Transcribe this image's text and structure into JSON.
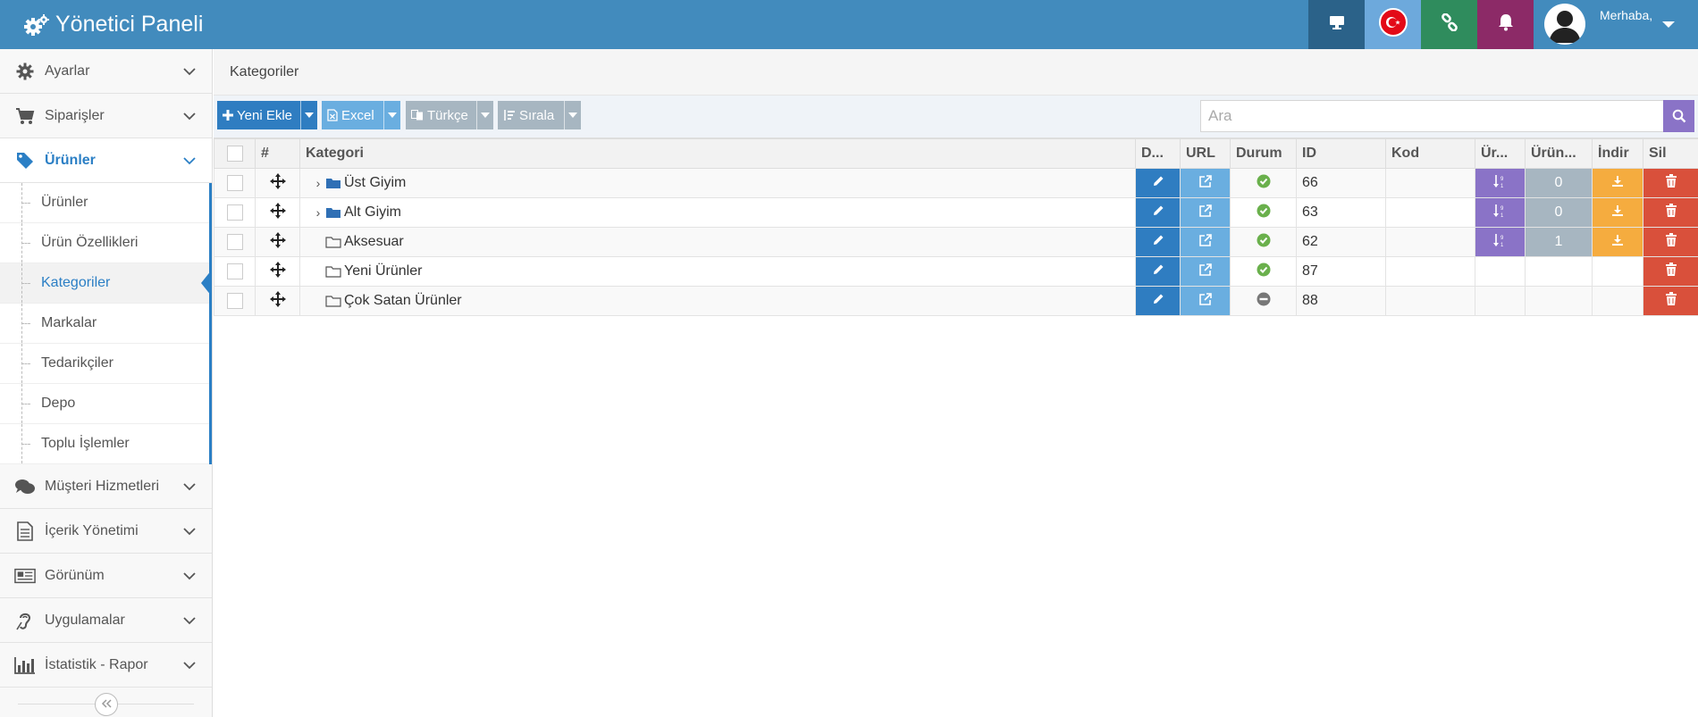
{
  "header": {
    "title": "Yönetici Paneli",
    "greeting": "Merhaba,"
  },
  "colors": {
    "header": "#428bbd",
    "primary": "#2f7dc1",
    "info": "#6aaee0",
    "purple": "#8a73c7",
    "grey": "#a7b6c1",
    "orange": "#f5ac3f",
    "danger": "#d9503b",
    "success": "#6ab04c"
  },
  "sidebar": {
    "items": [
      {
        "label": "Ayarlar",
        "icon": "gear-icon"
      },
      {
        "label": "Siparişler",
        "icon": "cart-icon"
      },
      {
        "label": "Ürünler",
        "icon": "tag-icon"
      },
      {
        "label": "Müşteri Hizmetleri",
        "icon": "comments-icon"
      },
      {
        "label": "İçerik Yönetimi",
        "icon": "document-icon"
      },
      {
        "label": "Görünüm",
        "icon": "newspaper-icon"
      },
      {
        "label": "Uygulamalar",
        "icon": "hearing-icon"
      },
      {
        "label": "İstatistik - Rapor",
        "icon": "bar-chart-icon"
      }
    ],
    "submenu": [
      "Ürünler",
      "Ürün Özellikleri",
      "Kategoriler",
      "Markalar",
      "Tedarikçiler",
      "Depo",
      "Toplu İşlemler"
    ]
  },
  "breadcrumb": "Kategoriler",
  "toolbar": {
    "new": "Yeni Ekle",
    "excel": "Excel",
    "lang": "Türkçe",
    "sort": "Sırala",
    "search_placeholder": "Ara"
  },
  "table": {
    "headers": [
      "#",
      "Kategori",
      "D...",
      "URL",
      "Durum",
      "ID",
      "Kod",
      "Ür...",
      "Ürün...",
      "İndir",
      "Sil"
    ],
    "rows": [
      {
        "name": "Üst Giyim",
        "id": "66",
        "count": "0"
      },
      {
        "name": "Alt Giyim",
        "id": "63",
        "count": "0"
      },
      {
        "name": "Aksesuar",
        "id": "62",
        "count": "1"
      },
      {
        "name": "Yeni Ürünler",
        "id": "87"
      },
      {
        "name": "Çok Satan Ürünler",
        "id": "88"
      }
    ]
  }
}
